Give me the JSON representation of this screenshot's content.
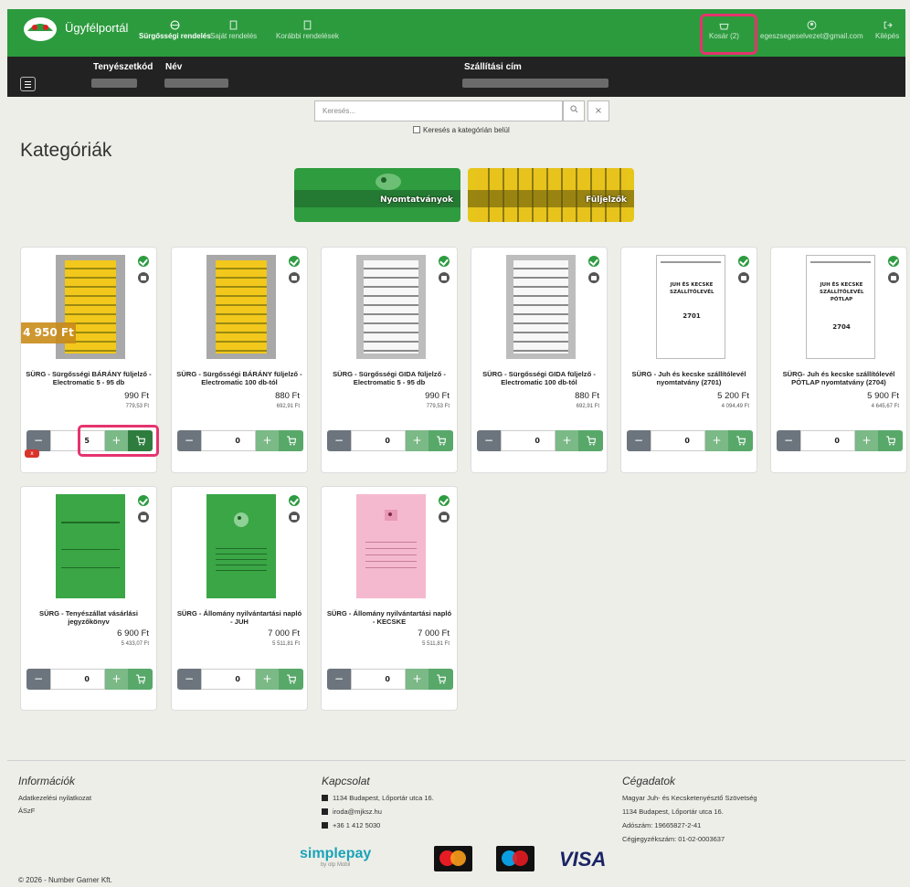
{
  "nav": {
    "brand": "Ügyfélportál",
    "items": [
      {
        "label": "Sürgősségi rendelés",
        "icon": "web-icon"
      },
      {
        "label": "Saját rendelés",
        "icon": "document-icon"
      },
      {
        "label": "Korábbi rendelések",
        "icon": "document-icon"
      }
    ],
    "cart": "Kosár (2)",
    "email": "egeszsegeselvezet@gmail.com",
    "logout": "Kilépés"
  },
  "customer": {
    "col1": "Tenyészetkód",
    "col2": "Név",
    "col3": "Szállítási cím"
  },
  "search": {
    "placeholder": "Keresés...",
    "checkbox_label": "Keresés a kategórián belül"
  },
  "categories": {
    "title": "Kategóriák",
    "tiles": [
      "Nyomtatványok",
      "Füljelzők"
    ]
  },
  "products": [
    {
      "name": "SÜRG - Sürgősségi BÁRÁNY füljelző - Electromatic 5 - 95 db",
      "price": "990 Ft",
      "net": "779,53 Ft",
      "qty": "5",
      "badge": "4 950 Ft"
    },
    {
      "name": "SÜRG - Sürgősségi BÁRÁNY füljelző - Electromatic 100 db-tól",
      "price": "880 Ft",
      "net": "692,91 Ft",
      "qty": "0"
    },
    {
      "name": "SÜRG - Sürgősségi GIDA füljelző - Electromatic 5 - 95 db",
      "price": "990 Ft",
      "net": "779,53 Ft",
      "qty": "0"
    },
    {
      "name": "SÜRG - Sürgősségi GIDA füljelző - Electromatic 100 db-tól",
      "price": "880 Ft",
      "net": "692,91 Ft",
      "qty": "0"
    },
    {
      "name": "SÜRG - Juh és kecske szállítólevél nyomtatvány (2701)",
      "price": "5 200 Ft",
      "net": "4 094,49 Ft",
      "qty": "0",
      "doc_title": "JUH ÉS KECSKE SZÁLLÍTÓLEVÉL",
      "doc_no": "2701"
    },
    {
      "name": "SÜRG- Juh és kecske szállítólevél PÓTLAP nyomtatvány (2704)",
      "price": "5 900 Ft",
      "net": "4 645,67 Ft",
      "qty": "0",
      "doc_title": "JUH ÉS KECSKE SZÁLLÍTÓLEVÉL PÓTLAP",
      "doc_no": "2704"
    },
    {
      "name": "SÜRG - Tenyészállat vásárlási jegyzőkönyv",
      "price": "6 900 Ft",
      "net": "5 433,07 Ft",
      "qty": "0"
    },
    {
      "name": "SÜRG - Állomány nyilvántartási napló - JUH",
      "price": "7 000 Ft",
      "net": "5 511,81 Ft",
      "qty": "0"
    },
    {
      "name": "SÜRG - Állomány nyilvántartási napló - KECSKE",
      "price": "7 000 Ft",
      "net": "5 511,81 Ft",
      "qty": "0"
    }
  ],
  "footer": {
    "info_title": "Információk",
    "info_links": [
      "Adatkezelési nyilatkozat",
      "ÁSzF"
    ],
    "contact_title": "Kapcsolat",
    "address": "1134 Budapest, Lőportár utca 16.",
    "email": "iroda@mjksz.hu",
    "phone": "+36 1 412 5030",
    "company_title": "Cégadatok",
    "company_lines": [
      "Magyar Juh- és Kecsketenyésztő Szövetség",
      "1134 Budapest, Lőportár utca 16.",
      "Adószám: 19665827-2-41",
      "Cégjegyzékszám: 01-02-0003637"
    ],
    "copyright": "© 2026 - Number Garner Kft.",
    "simplepay": "simplepay",
    "simplepay_sub": "by otp Mobil",
    "visa": "VISA"
  },
  "colors": {
    "brand_green": "#2c9b3e",
    "highlight": "#e5336e"
  }
}
